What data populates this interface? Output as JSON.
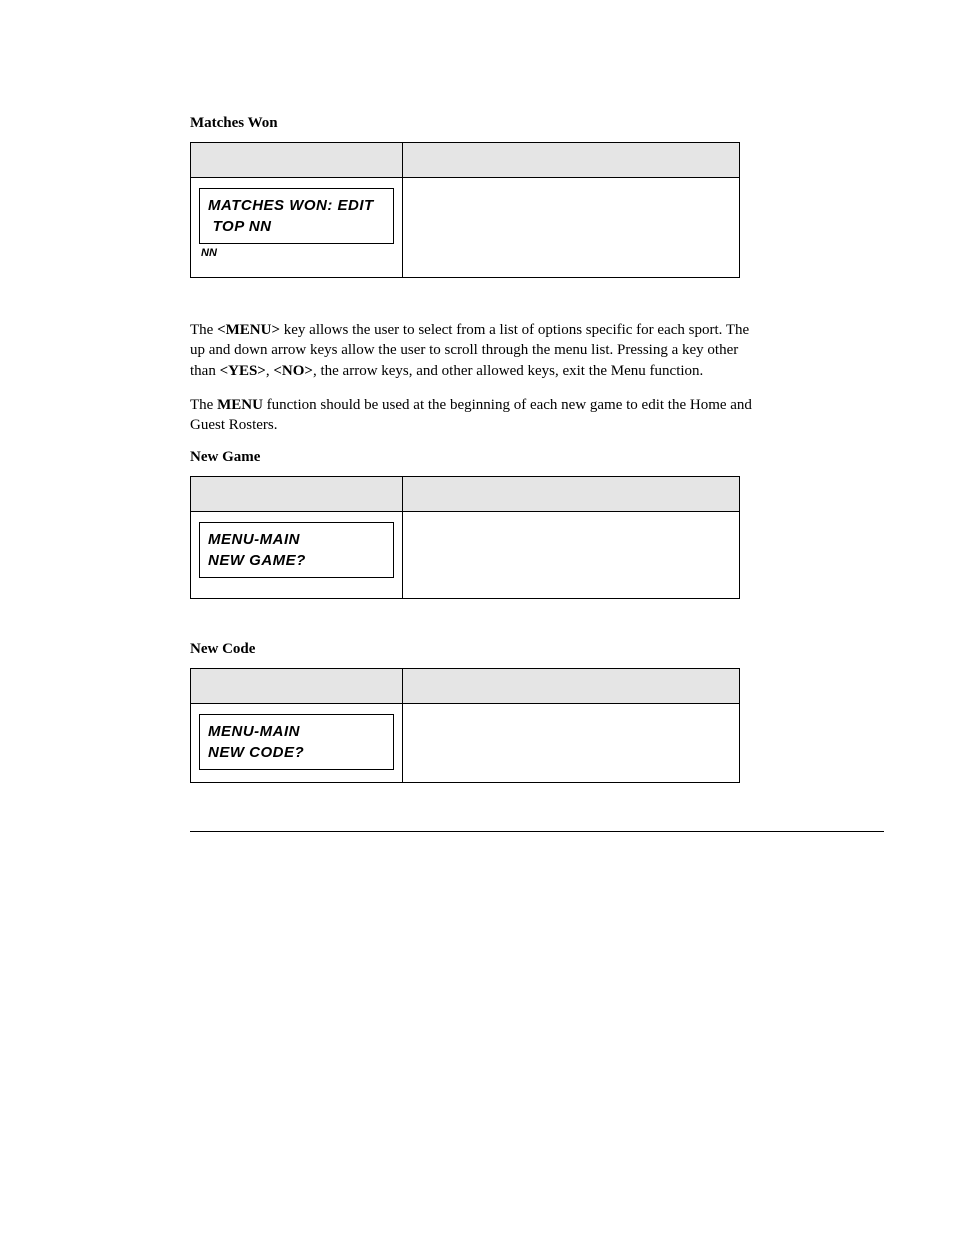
{
  "sections": [
    {
      "heading": "Matches Won",
      "lcd_line1": "MATCHES WON: EDIT",
      "lcd_line2": " TOP NN",
      "subnote": "NN",
      "box_class": "tall1"
    },
    {
      "heading": "New Game",
      "lcd_line1": "MENU-MAIN",
      "lcd_line2": "NEW GAME?",
      "subnote": "",
      "box_class": "tall2"
    },
    {
      "heading": "New Code",
      "lcd_line1": "MENU-MAIN",
      "lcd_line2": "NEW CODE?",
      "subnote": "",
      "box_class": "tall3"
    }
  ],
  "para1": {
    "t1": "The ",
    "b1": "<MENU>",
    "t2": " key allows the user to select from a list of options specific for each sport.  The up and down arrow keys allow the user to scroll through the menu list.  Pressing a key other than ",
    "b2": "<YES>",
    "t3": ", ",
    "b3": "<NO>",
    "t4": ", the arrow keys, and other allowed keys, exit the Menu function."
  },
  "para2": {
    "t1": "The ",
    "b1": "MENU",
    "t2": " function should be used at the beginning of each new game to edit the Home and Guest Rosters."
  }
}
